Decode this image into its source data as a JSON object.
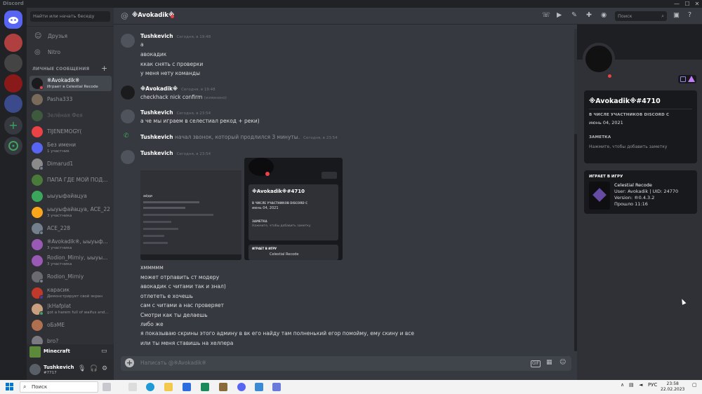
{
  "window": {
    "title": "Discord",
    "minimize": "—",
    "maximize": "☐",
    "close": "✕"
  },
  "dm_sidebar": {
    "search_placeholder": "Найти или начать беседу",
    "friends_label": "Друзья",
    "nitro_label": "Nitro",
    "dm_header": "ЛИЧНЫЕ СООБЩЕНИЯ",
    "add": "+",
    "items": [
      {
        "name": "※Avokadik※",
        "sub": "Играет в Celestial Recode",
        "color": "#1b1b1d",
        "status": "#ed4245"
      },
      {
        "name": "Pasha333",
        "sub": "",
        "color": "#7a6a5a",
        "status": ""
      },
      {
        "name": "Зелёная Фея",
        "sub": "",
        "color": "#3e5a3e",
        "status": ""
      },
      {
        "name": "TIJENEMOGY(",
        "sub": "",
        "color": "#ed4245",
        "status": ""
      },
      {
        "name": "Без имени",
        "sub": "1 участник",
        "color": "#5865f2",
        "status": ""
      },
      {
        "name": "Dimarud1",
        "sub": "",
        "color": "#8a8a8a",
        "status": "#747f8d"
      },
      {
        "name": "ПАПА ГДЕ МОЙ ПОД...",
        "sub": "",
        "color": "#4a7a3a",
        "status": ""
      },
      {
        "name": "ыыуыфайацуа",
        "sub": "",
        "color": "#3ba55c",
        "status": ""
      },
      {
        "name": "ыыуыфайацуа, ACE_228",
        "sub": "3 участника",
        "color": "#faa61a",
        "status": ""
      },
      {
        "name": "ACE_228",
        "sub": "",
        "color": "#747f8d",
        "status": "#747f8d"
      },
      {
        "name": "※Avokadik※, ыыуыф...",
        "sub": "3 участника",
        "color": "#9b59b6",
        "status": ""
      },
      {
        "name": "Rodion_Mirniy, ыыуы...",
        "sub": "3 участника",
        "color": "#9b59b6",
        "status": ""
      },
      {
        "name": "Rodion_Mirniy",
        "sub": "",
        "color": "#6a6a70",
        "status": "#747f8d"
      },
      {
        "name": "карасик",
        "sub": "Демонстрирует свой экран",
        "color": "#c0392b",
        "status": "#593695"
      },
      {
        "name": "|kHafplat",
        "sub": "got a harem full of waifus and...",
        "color": "#c8a080",
        "status": "#3ba55c"
      },
      {
        "name": "оБэМЕ",
        "sub": "",
        "color": "#b07050",
        "status": ""
      },
      {
        "name": "bro?",
        "sub": "",
        "color": "#7a7a80",
        "status": ""
      }
    ]
  },
  "activity": {
    "game": "Minecraft"
  },
  "user_panel": {
    "username": "Tushkevich",
    "tag": "#7717"
  },
  "chat": {
    "title": "※Avokadik※",
    "search_placeholder": "Поиск",
    "composer_placeholder": "Написать @※Avokadik※",
    "gif": "GIF",
    "messages": {
      "m1_name": "Tushkevich",
      "m1_time": "Сегодня, в 19:48",
      "m1_lines": [
        "а",
        "авокадик",
        "ккак снять с проверки",
        "у меня нету команды"
      ],
      "m2_name": "※Avokadik※",
      "m2_time": "Сегодня, в 19:48",
      "m2_line": "checkhack nick confirm",
      "m2_edited": "(изменено)",
      "m3_name": "Tushkevich",
      "m3_time": "Сегодня, в 23:54",
      "m3_line": "а че мы играем в селестиал рекод + реки)",
      "call_name": "Tushkevich",
      "call_text": " начал звонок, который продлился 3 минуты.",
      "call_time": "Сегодня, в 23:54",
      "m4_name": "Tushkevich",
      "m4_time": "Сегодня, в 23:54",
      "m4_lines": [
        "хммммм",
        "может отрпавить ст модеру",
        "авокадик с читами так и знал)",
        "отлететь е хочешь",
        "сам с читами а нас проверяет",
        "Смотри как ты делаешь",
        "либо же",
        "я показываю скрины этого админу в вк его найду там полненький егор помойму, ему скину и все",
        "или ты меня ставишь на хелпера"
      ],
      "attachment2_username": "※Avokadik※#4710",
      "attachment2_member_since": "В ЧИСЛЕ УЧАСТНИКОВ DISCORD С",
      "attachment2_date": "июнь 04, 2021",
      "attachment2_note": "ЗАМЕТКА",
      "attachment2_note_hint": "Нажмите, чтобы добавить заметку",
      "attachment2_playing": "ИГРАЕТ В ИГРУ",
      "attachment2_game": "Celestial Recode",
      "attachment1_title": "айди"
    }
  },
  "profile": {
    "username": "※Avokadik※#4710",
    "member_since_label": "В ЧИСЛЕ УЧАСТНИКОВ DISCORD С",
    "member_since": "июнь 04, 2021",
    "note_label": "ЗАМЕТКА",
    "note_hint": "Нажмите, чтобы добавить заметку",
    "playing_label": "ИГРАЕТ В ИГРУ",
    "game_title": "Celestial Recode",
    "game_user": "User: Avokadik | UID: 24770",
    "game_version": "Version: ®0.4.3.2",
    "game_elapsed": "Прошло 11:16"
  },
  "taskbar": {
    "search": "Поиск",
    "lang": "РУС",
    "time": "23:58",
    "date": "22.02.2023"
  }
}
